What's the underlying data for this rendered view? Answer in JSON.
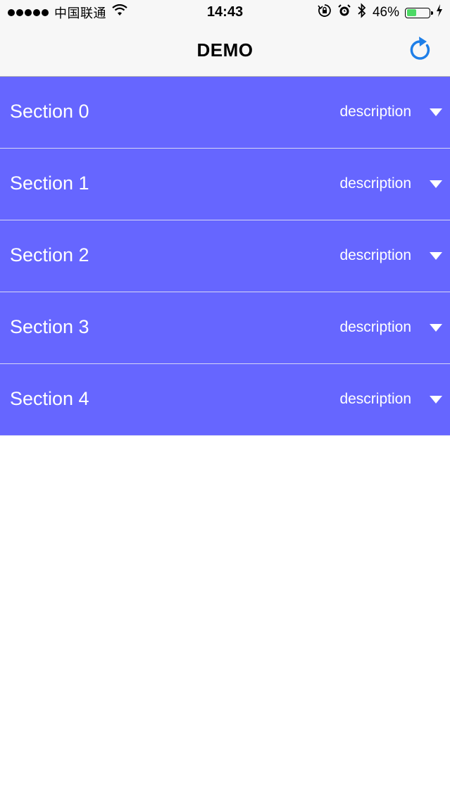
{
  "status_bar": {
    "carrier": "中国联通",
    "time": "14:43",
    "battery_percent_label": "46%",
    "battery_level": 0.46,
    "icons": [
      "signal-dots-icon",
      "wifi-icon",
      "rotation-lock-icon",
      "alarm-icon",
      "bluetooth-icon",
      "battery-icon",
      "charging-bolt-icon"
    ]
  },
  "nav": {
    "title": "DEMO",
    "refresh_icon": "refresh-icon",
    "accent_color": "#1e7fe8"
  },
  "theme": {
    "section_background": "#6666ff",
    "section_text": "#ffffff"
  },
  "sections": [
    {
      "title": "Section 0",
      "description": "description",
      "icon": "chevron-down-icon"
    },
    {
      "title": "Section 1",
      "description": "description",
      "icon": "chevron-down-icon"
    },
    {
      "title": "Section 2",
      "description": "description",
      "icon": "chevron-down-icon"
    },
    {
      "title": "Section 3",
      "description": "description",
      "icon": "chevron-down-icon"
    },
    {
      "title": "Section 4",
      "description": "description",
      "icon": "chevron-down-icon"
    }
  ]
}
